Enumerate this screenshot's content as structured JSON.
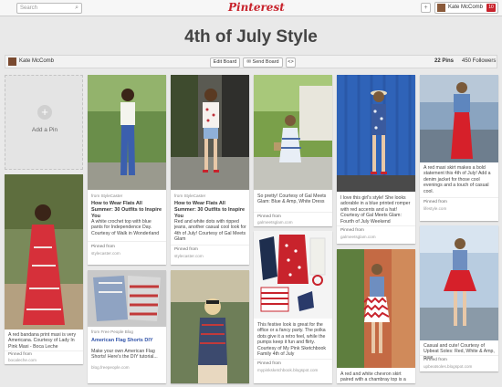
{
  "topbar": {
    "search_placeholder": "Search",
    "logo": "Pinterest",
    "user_name": "Kate McComb",
    "notification_count": "10"
  },
  "board": {
    "title": "4th of July Style",
    "owner": "Kate McComb",
    "edit_label": "Edit Board",
    "send_label": "Send Board",
    "embed_label": "<>",
    "pins_count": "22 Pins",
    "followers_count": "450 Followers"
  },
  "add_pin": {
    "label": "Add a Pin"
  },
  "pins": {
    "p1": {
      "text": "A red bandana print maxi is very Americana. Courtesy of Lady In Pink Maxi - Boca Leche",
      "pinned_from": "Pinned from",
      "source": "bocaleche.com"
    },
    "p2": {
      "via": "from StyleCaster",
      "title": "How to Wear Flats All Summer: 30 Outfits to Inspire You",
      "text": "A white crochet top with blue pants for Independence Day. Courtesy of Walk in Wonderland",
      "pinned_from": "Pinned from",
      "source": "stylecaster.com"
    },
    "p3": {
      "via": "from StyleCaster",
      "title": "How to Wear Flats All Summer: 30 Outfits to Inspire You",
      "text": "Red and white dots with ripped jeans, another casual cool look for 4th of July! Courtesy of Gal Meets Glam",
      "pinned_from": "Pinned from",
      "source": "stylecaster.com"
    },
    "p4": {
      "text": "So pretty! Courtesy of Gal Meets Glam: Blue & Amp, White Dress",
      "pinned_from": "Pinned from",
      "source": "galmeetsglam.com"
    },
    "p5": {
      "text": "I love this girl's style! She looks adorable in a blue printed romper with red accents and a hat! Courtesy of Gal Meets Glam: Fourth of July Weekend",
      "pinned_from": "Pinned from",
      "source": "galmeetsglam.com"
    },
    "p6": {
      "text": "A red maxi skirt makes a bold statement this 4th of July! Add a denim jacket for those cool evenings and a touch of casual cool.",
      "pinned_from": "Pinned from",
      "source": "lifestyle.com"
    },
    "p7": {
      "via": "from Free People Blog",
      "title": "American Flag Shorts DIY",
      "text": "Make your own American Flag Shorts! Here's the DIY tutorial...",
      "source": "blog.freepeople.com"
    },
    "p8": {
      "text": "This festive look is great for the office or a fancy party. The polka dots give it a retro feel, while the pumps keep it fun and flirty. Courtesy of My Pink Sketchbook Family 4th of July",
      "pinned_from": "Pinned from",
      "source": "mypinksketchbook.blogspot.com"
    },
    "p9": {
      "text": "Casual and cute! Courtesy of Upbeat Soles: Red, White & Amp, Blue",
      "pinned_from": "Pinned from",
      "source": "upbeatsoles.blogspot.com"
    },
    "p10": {
      "text": "A red and white chevron skirt paired with a chambray top is a"
    }
  },
  "colors": {
    "accent": "#c8232c",
    "background": "#e9e9e9"
  }
}
